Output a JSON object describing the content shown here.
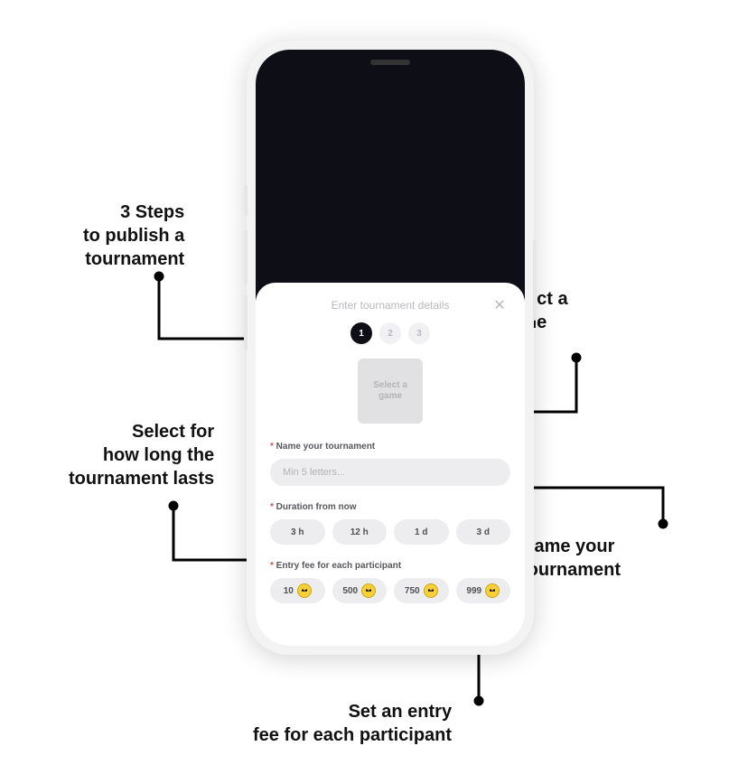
{
  "callouts": {
    "steps": "3 Steps\nto publish a\ntournament",
    "select_game": "Select a\ngame",
    "duration": "Select for\nhow long the\ntournament lasts",
    "name": "Name your\ntournament",
    "entry_fee": "Set an entry\nfee for each participant"
  },
  "sheet": {
    "title": "Enter tournament details",
    "close_label": "✕",
    "step_labels": [
      "1",
      "2",
      "3"
    ],
    "active_step_index": 0,
    "game_select_label": "Select a\ngame",
    "fields": {
      "name_label": "Name your tournament",
      "name_placeholder": "Min 5 letters...",
      "duration_label": "Duration from now",
      "duration_options": [
        "3 h",
        "12 h",
        "1 d",
        "3 d"
      ],
      "fee_label": "Entry fee for each participant",
      "fee_options": [
        "10",
        "500",
        "750",
        "999"
      ]
    }
  },
  "colors": {
    "dark": "#0d0e16",
    "chip_bg": "#ededef",
    "coin": "#f8d13a"
  }
}
